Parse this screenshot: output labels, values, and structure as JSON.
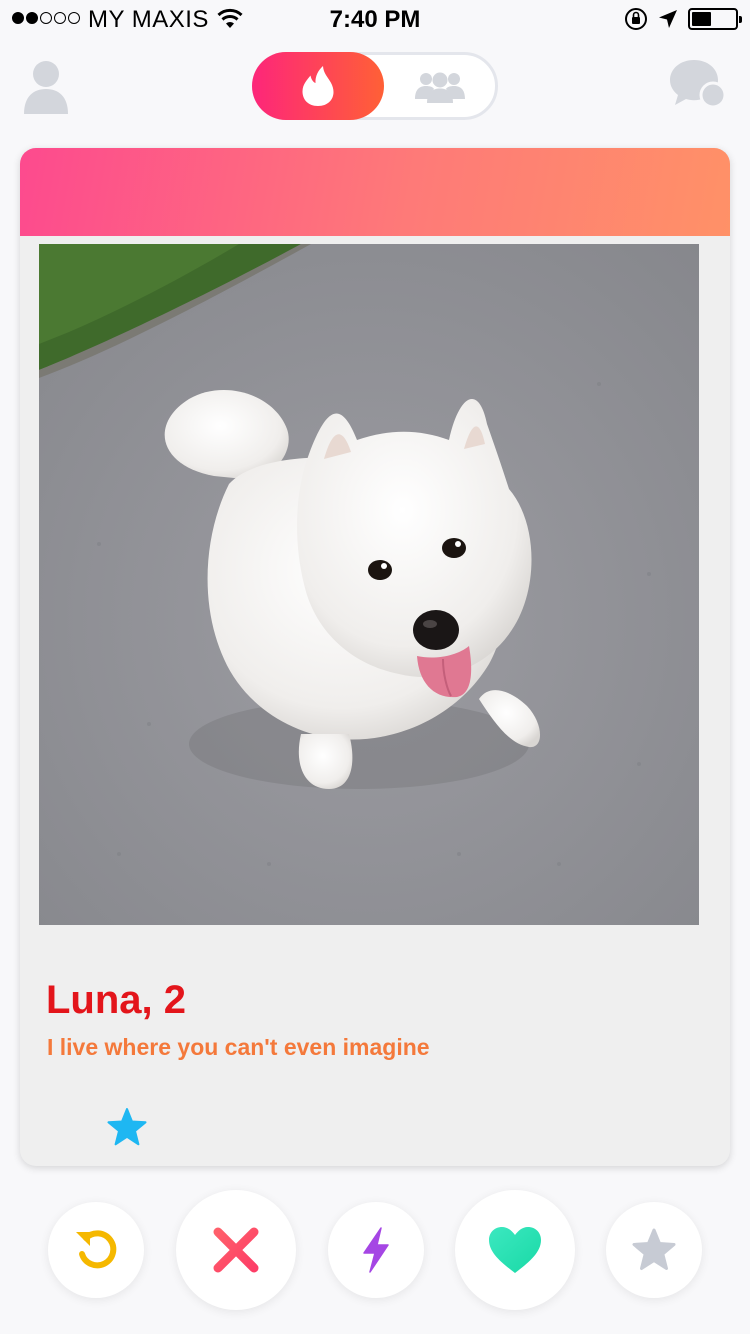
{
  "status_bar": {
    "carrier": "MY MAXIS",
    "time": "7:40 PM",
    "signal_bars_filled": 2,
    "signal_bars_total": 5,
    "battery_level": 0.45
  },
  "top_nav": {
    "profile_icon": "profile-icon",
    "discover_icon": "flame-icon",
    "group_icon": "group-icon",
    "messages_icon": "chat-icon",
    "active_tab": "discover"
  },
  "card": {
    "name_age": "Luna, 2",
    "bio": "I live where you can't even imagine",
    "photo_subject": "photo",
    "badge_icon": "star-icon"
  },
  "actions": [
    {
      "name": "rewind",
      "icon": "rewind-icon",
      "color": "#f5b800"
    },
    {
      "name": "nope",
      "icon": "close-icon",
      "color": "#fd5068"
    },
    {
      "name": "boost",
      "icon": "lightning-icon",
      "color": "#a546e4"
    },
    {
      "name": "like",
      "icon": "heart-icon",
      "color": "#1de9b6"
    },
    {
      "name": "super-like",
      "icon": "star-icon",
      "color": "#c7cbd4"
    }
  ],
  "colors": {
    "brand_pink": "#fd267a",
    "brand_orange": "#ff6036",
    "name_red": "#e3151b",
    "bio_orange": "#f4793b",
    "star_blue": "#1eb7f2"
  }
}
